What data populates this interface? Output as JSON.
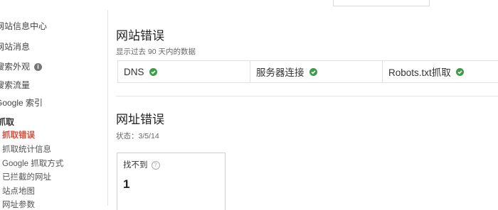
{
  "sidebar": {
    "items": [
      {
        "label": "网站信息中心"
      },
      {
        "label": "网站消息"
      },
      {
        "label": "搜索外观"
      },
      {
        "label": "搜索流量"
      },
      {
        "label": "Google 索引"
      },
      {
        "label": "抓取"
      },
      {
        "label": "抓取错误"
      },
      {
        "label": "抓取统计信息"
      },
      {
        "label": "Google 抓取方式"
      },
      {
        "label": "已拦截的网址"
      },
      {
        "label": "站点地图"
      },
      {
        "label": "网址参数"
      }
    ],
    "info_icon": "i"
  },
  "site_errors": {
    "title": "网站错误",
    "subtitle": "显示过去 90 天内的数据",
    "checks": [
      {
        "label": "DNS",
        "status_icon": "check-circle-icon"
      },
      {
        "label": "服务器连接",
        "status_icon": "check-circle-icon"
      },
      {
        "label": "Robots.txt抓取",
        "status_icon": "check-circle-icon"
      }
    ]
  },
  "url_errors": {
    "title": "网址错误",
    "status": "状态：3/5/14",
    "card": {
      "label": "找不到",
      "help_icon": "?",
      "value": "1"
    }
  },
  "colors": {
    "active": "#dd4b39",
    "ok": "#3c9d48"
  }
}
